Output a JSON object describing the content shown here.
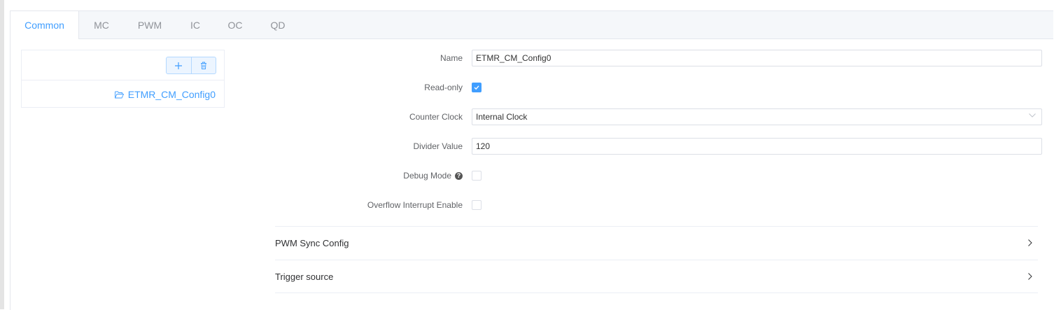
{
  "tabs": [
    "Common",
    "MC",
    "PWM",
    "IC",
    "OC",
    "QD"
  ],
  "active_tab": "Common",
  "tree": {
    "add_icon": "plus-icon",
    "delete_icon": "trash-icon",
    "node_icon": "folder-open-icon",
    "node_label": "ETMR_CM_Config0"
  },
  "form": {
    "name_label": "Name",
    "name_value": "ETMR_CM_Config0",
    "readonly_label": "Read-only",
    "readonly_checked": true,
    "counter_clock_label": "Counter Clock",
    "counter_clock_value": "Internal Clock",
    "divider_label": "Divider Value",
    "divider_value": "120",
    "debug_label": "Debug Mode",
    "debug_checked": false,
    "overflow_label": "Overflow Interrupt Enable",
    "overflow_checked": false
  },
  "sections": {
    "pwm_sync": "PWM Sync Config",
    "trigger_source": "Trigger source"
  },
  "colors": {
    "accent": "#409eff",
    "border": "#dcdfe6",
    "tab_bg": "#f5f7fa"
  }
}
